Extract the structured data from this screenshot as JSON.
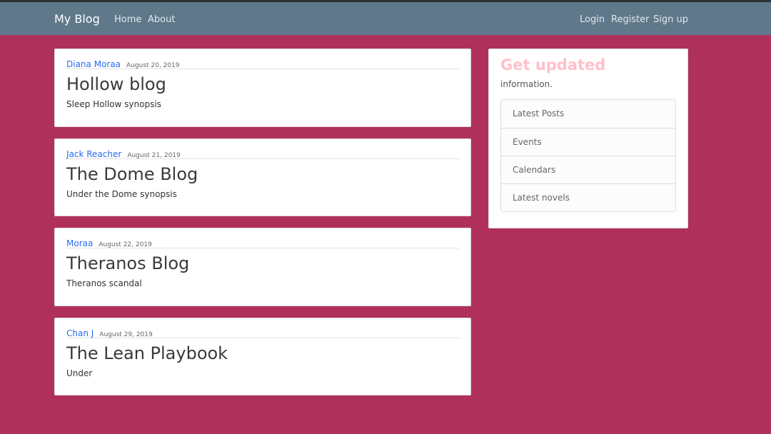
{
  "navbar": {
    "brand": "My Blog",
    "left_links": [
      "Home",
      "About"
    ],
    "right_links": [
      "Login",
      "Register",
      "Sign up"
    ]
  },
  "posts": [
    {
      "author": "Diana Moraa",
      "date": "August 20, 2019",
      "title": "Hollow blog",
      "summary": "Sleep Hollow synopsis"
    },
    {
      "author": "Jack Reacher",
      "date": "August 21, 2019",
      "title": "The Dome Blog",
      "summary": "Under the Dome synopsis"
    },
    {
      "author": "Moraa",
      "date": "August 22, 2019",
      "title": "Theranos Blog",
      "summary": "Theranos scandal"
    },
    {
      "author": "Chan J",
      "date": "August 29, 2019",
      "title": "The Lean Playbook",
      "summary": "Under"
    }
  ],
  "sidebar": {
    "heading": "Get updated",
    "text": "information.",
    "items": [
      "Latest Posts",
      "Events",
      "Calendars",
      "Latest novels"
    ]
  },
  "colors": {
    "background": "#b0305c",
    "navbar": "#5f788a",
    "heading": "#ffc0cb",
    "link": "#2a6cf0"
  }
}
